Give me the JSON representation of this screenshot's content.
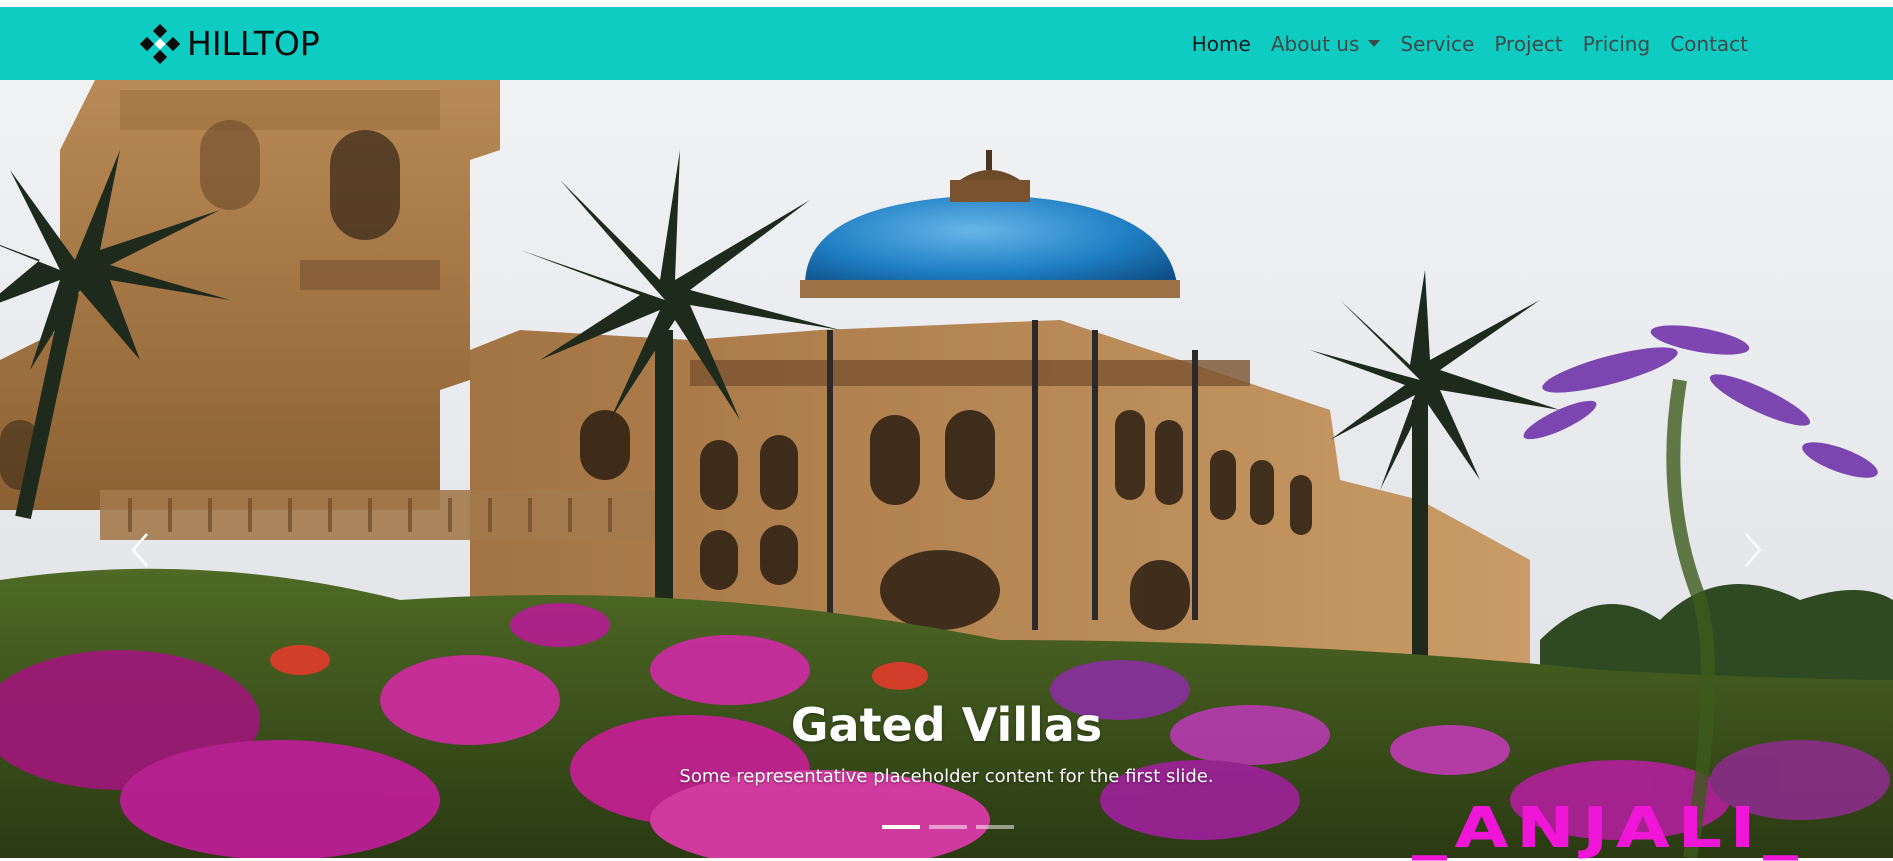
{
  "navbar": {
    "brand": "HILLTOP",
    "links": [
      {
        "label": "Home",
        "active": true
      },
      {
        "label": "About us",
        "dropdown": true
      },
      {
        "label": "Service"
      },
      {
        "label": "Project"
      },
      {
        "label": "Pricing"
      },
      {
        "label": "Contact"
      }
    ],
    "background": "#0fccc2"
  },
  "carousel": {
    "slide_title": "Gated Villas",
    "slide_text": "Some representative placeholder content for the first slide.",
    "indicator_count": 3,
    "active_indicator": 0,
    "prev_icon": "chevron-left-icon",
    "next_icon": "chevron-right-icon"
  },
  "watermark": {
    "text": "_ANJALI_",
    "color": "#ef16d8"
  }
}
